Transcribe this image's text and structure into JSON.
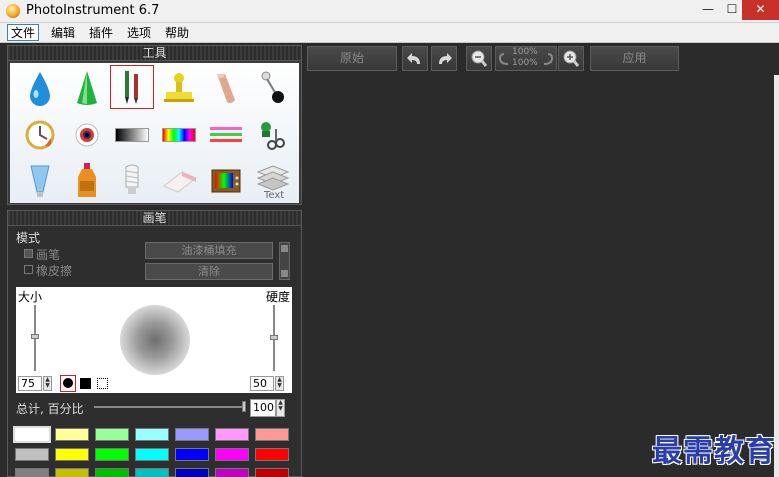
{
  "window": {
    "title": "PhotoInstrument 6.7",
    "minimize_label": "—",
    "maximize_label": "☐"
  },
  "menu": [
    "文件",
    "编辑",
    "插件",
    "选项",
    "帮助"
  ],
  "tools_panel": {
    "header": "工具",
    "tools": [
      "water-drop-tool-icon",
      "cone-tool-icon",
      "brush-tool-icon",
      "stamp-tool-icon",
      "finger-tool-icon",
      "pin-tool-icon",
      "clock-tool-icon",
      "eye-tool-icon",
      "gradient-tool-icon",
      "rainbow-tool-icon",
      "lines-tool-icon",
      "scissors-tool-icon",
      "glass-tool-icon",
      "bottle-tool-icon",
      "bulb-tool-icon",
      "eraser-tool-icon",
      "tv-tool-icon",
      "text-layers-tool-icon"
    ]
  },
  "brush_panel": {
    "header": "画笔",
    "mode_label": "模式",
    "brush_label": "画笔",
    "eraser_label": "橡皮擦",
    "fill_button": "油漆桶填充",
    "clear_button": "清除",
    "size_label": "大小",
    "hardness_label": "硬度",
    "size_value": "75",
    "hardness_value": "50",
    "total_label": "总计, 百分比",
    "total_value": "100",
    "swatch_colors": [
      [
        "#ffffff",
        "#ffff99",
        "#99ff99",
        "#99ffff",
        "#9999ff",
        "#ff99ff",
        "#ff9999"
      ],
      [
        "#c0c0c0",
        "#ffff00",
        "#00ff00",
        "#00ffff",
        "#0000ff",
        "#ff00ff",
        "#ff0000"
      ],
      [
        "#808080",
        "#c0c000",
        "#00c000",
        "#00c0c0",
        "#0000c0",
        "#c000c0",
        "#c00000"
      ]
    ]
  },
  "toolbar": {
    "original_button": "原始",
    "apply_button": "应用",
    "zoom_top": "100%",
    "zoom_bottom": "100%"
  },
  "watermark": "最需教育"
}
